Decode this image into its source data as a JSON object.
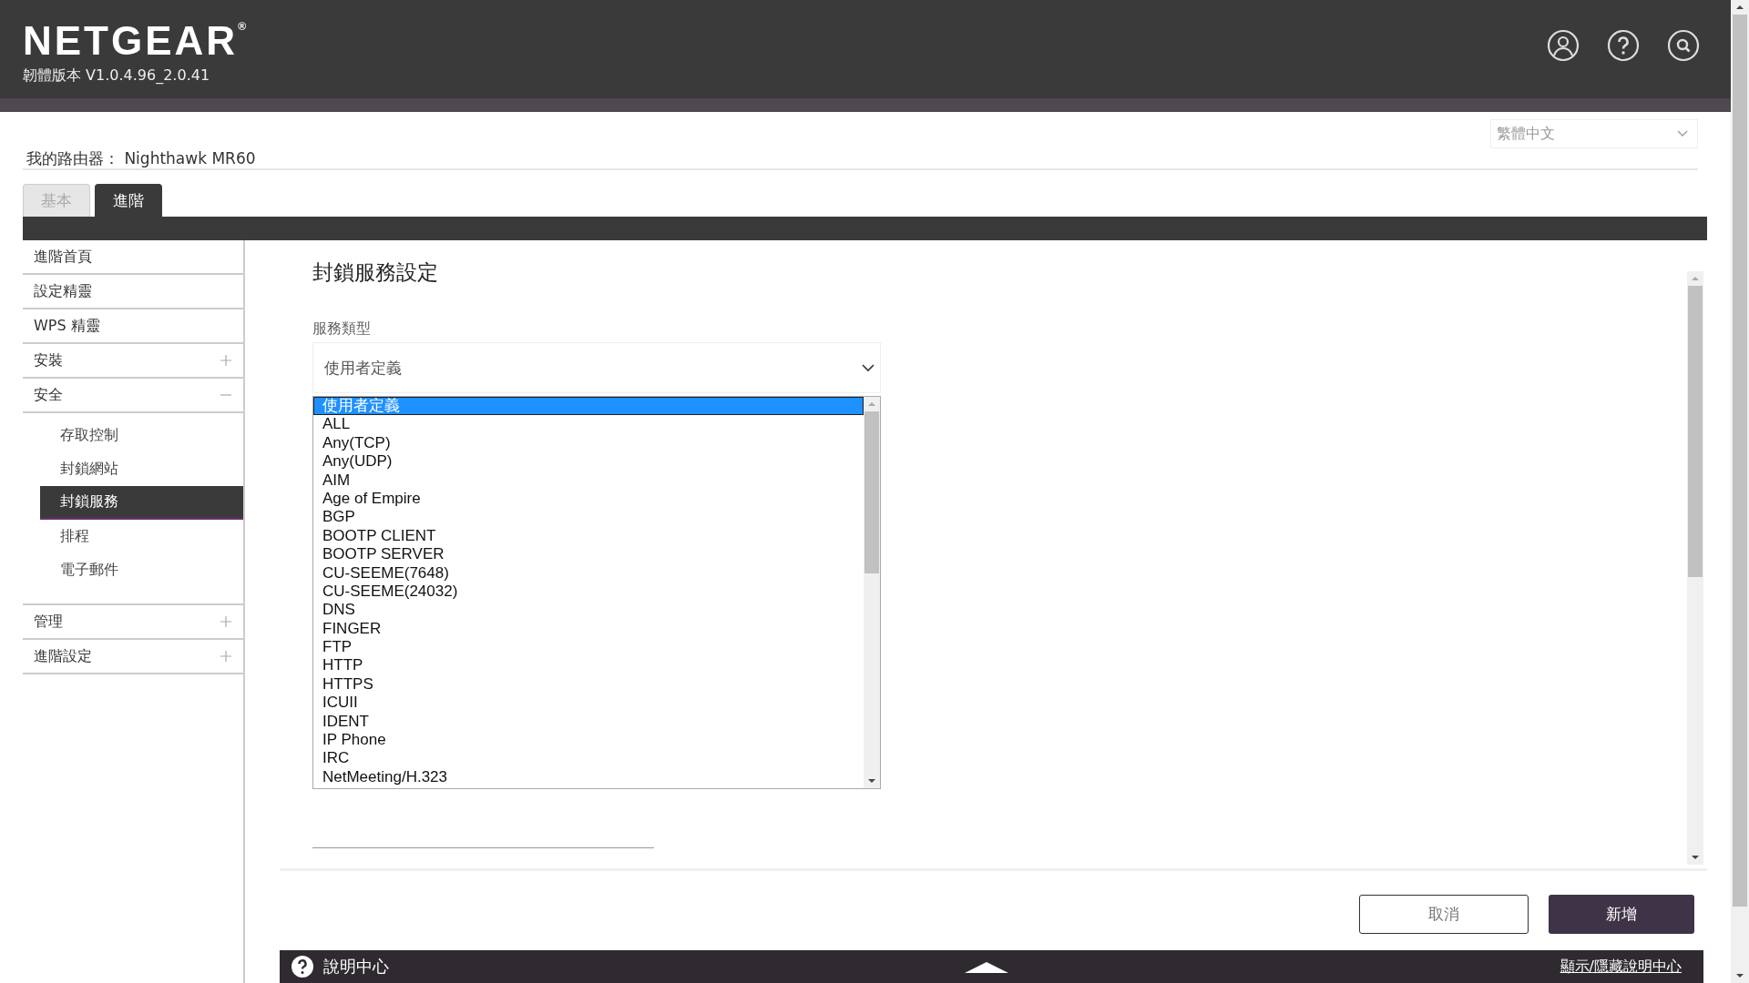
{
  "header": {
    "logo": "NETGEAR",
    "logo_mark": "®",
    "firmware": "韌體版本 V1.0.4.96_2.0.41"
  },
  "router": {
    "label": "我的路由器：",
    "name": "Nighthawk MR60"
  },
  "language": {
    "value": "繁體中文"
  },
  "tabs": [
    {
      "label": "基本",
      "selected": false
    },
    {
      "label": "進階",
      "selected": true
    }
  ],
  "sidebar": {
    "items": [
      {
        "label": "進階首頁"
      },
      {
        "label": "設定精靈"
      },
      {
        "label": "WPS 精靈"
      },
      {
        "label": "安裝",
        "expanded": false
      },
      {
        "label": "安全",
        "expanded": true,
        "children": [
          {
            "label": "存取控制",
            "selected": false
          },
          {
            "label": "封鎖網站",
            "selected": false
          },
          {
            "label": "封鎖服務",
            "selected": true
          },
          {
            "label": "排程",
            "selected": false
          },
          {
            "label": "電子郵件",
            "selected": false
          }
        ]
      },
      {
        "label": "管理",
        "expanded": false
      },
      {
        "label": "進階設定",
        "expanded": false
      }
    ]
  },
  "page_title": "封鎖服務設定",
  "service_type": {
    "label": "服務類型",
    "value": "使用者定義",
    "options": [
      {
        "label": "使用者定義",
        "selected": true
      },
      {
        "label": "ALL",
        "selected": false
      },
      {
        "label": "Any(TCP)",
        "selected": false
      },
      {
        "label": "Any(UDP)",
        "selected": false
      },
      {
        "label": "AIM",
        "selected": false
      },
      {
        "label": "Age of Empire",
        "selected": false
      },
      {
        "label": "BGP",
        "selected": false
      },
      {
        "label": "BOOTP CLIENT",
        "selected": false
      },
      {
        "label": "BOOTP SERVER",
        "selected": false
      },
      {
        "label": "CU-SEEME(7648)",
        "selected": false
      },
      {
        "label": "CU-SEEME(24032)",
        "selected": false
      },
      {
        "label": "DNS",
        "selected": false
      },
      {
        "label": "FINGER",
        "selected": false
      },
      {
        "label": "FTP",
        "selected": false
      },
      {
        "label": "HTTP",
        "selected": false
      },
      {
        "label": "HTTPS",
        "selected": false
      },
      {
        "label": "ICUII",
        "selected": false
      },
      {
        "label": "IDENT",
        "selected": false
      },
      {
        "label": "IP Phone",
        "selected": false
      },
      {
        "label": "IRC",
        "selected": false
      },
      {
        "label": "NetMeeting/H.323",
        "selected": false
      }
    ]
  },
  "buttons": [
    {
      "label": "取消",
      "kind": "secondary"
    },
    {
      "label": "新增",
      "kind": "primary"
    }
  ],
  "help_bar": {
    "title": "說明中心",
    "toggle": "顯示/隱藏說明中心"
  }
}
